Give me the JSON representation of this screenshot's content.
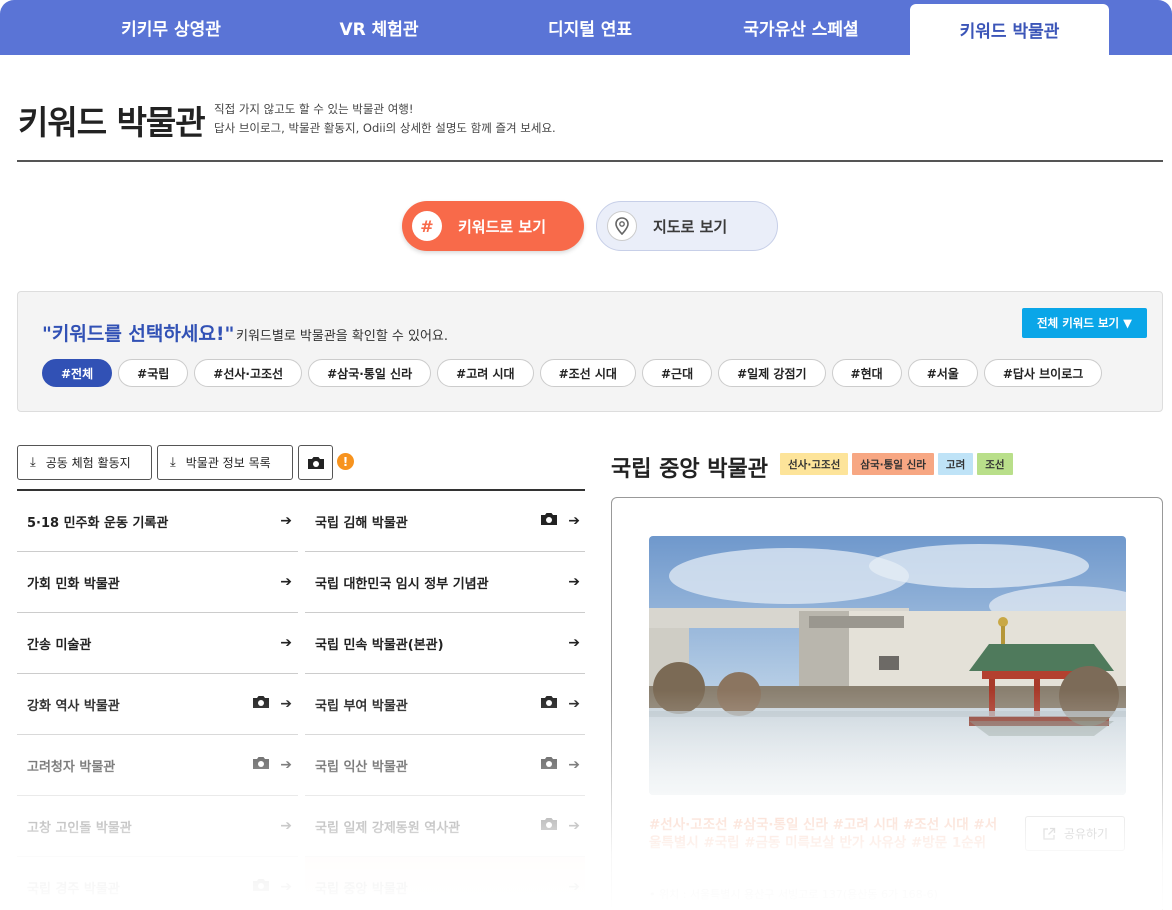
{
  "nav": {
    "tabs": [
      {
        "label": "키키무 상영관"
      },
      {
        "label": "VR 체험관"
      },
      {
        "label": "디지털 연표"
      },
      {
        "label": "국가유산 스페셜"
      },
      {
        "label": "키워드 박물관"
      }
    ],
    "active_index": 4
  },
  "header": {
    "title": "키워드 박물관",
    "subtitle_line1": "직접 가지 않고도 할 수 있는 박물관 여행!",
    "subtitle_line2": "답사 브이로그, 박물관 활동지, Odii의 상세한 설명도 함께 즐겨 보세요."
  },
  "view_toggle": {
    "keyword_label": "키워드로 보기",
    "map_label": "지도로 보기",
    "keyword_icon": "#"
  },
  "keyword_panel": {
    "prompt": "\"키워드를 선택하세요!\"",
    "prompt_sub": "키워드별로 박물관을 확인할 수 있어요.",
    "all_button": "전체 키워드 보기 ▼",
    "chips": [
      "#전체",
      "#국립",
      "#선사·고조선",
      "#삼국·통일 신라",
      "#고려 시대",
      "#조선 시대",
      "#근대",
      "#일제 강점기",
      "#현대",
      "#서울",
      "#답사 브이로그"
    ],
    "active_chip": 0
  },
  "toolbar": {
    "activity_button": "공동 체험 활동지",
    "info_button": "박물관 정보 목록",
    "download_icon": "⤓",
    "warning_glyph": "!"
  },
  "museums_left": [
    {
      "name": "5·18 민주화 운동 기록관",
      "photo": false
    },
    {
      "name": "가회 민화 박물관",
      "photo": false
    },
    {
      "name": "간송 미술관",
      "photo": false
    },
    {
      "name": "강화 역사 박물관",
      "photo": true
    },
    {
      "name": "고려청자 박물관",
      "photo": true
    },
    {
      "name": "고창 고인돌 박물관",
      "photo": false
    },
    {
      "name": "국립 경주 박물관",
      "photo": true
    }
  ],
  "museums_right": [
    {
      "name": "국립 김해 박물관",
      "photo": true
    },
    {
      "name": "국립 대한민국 임시 정부 기념관",
      "photo": false
    },
    {
      "name": "국립 민속 박물관(본관)",
      "photo": false
    },
    {
      "name": "국립 부여 박물관",
      "photo": true
    },
    {
      "name": "국립 익산 박물관",
      "photo": true
    },
    {
      "name": "국립 일제 강제동원 역사관",
      "photo": true
    },
    {
      "name": "국립 중앙 박물관",
      "photo": false
    }
  ],
  "detail": {
    "title": "국립 중앙 박물관",
    "tags": [
      {
        "label": "선사·고조선",
        "color": "#fde49a"
      },
      {
        "label": "삼국·통일 신라",
        "color": "#f7a783"
      },
      {
        "label": "고려",
        "color": "#bfe3f7"
      },
      {
        "label": "조선",
        "color": "#b9df8a"
      }
    ],
    "hashtags": "#선사·고조선 #삼국·통일 신라 #고려 시대 #조선 시대 #서울특별시 #국립 #금동 미륵보살 반가 사유상 #방문 1순위",
    "share_label": "공유하기",
    "address": "• 위치 : 서울특별시 용산구 서빙고로 137(용산동 6가 168-6)"
  },
  "colors": {
    "nav_bg": "#5a74d6",
    "accent_orange": "#f86a4a",
    "accent_blue": "#3151b5",
    "cyan_button": "#0aa6e8"
  }
}
